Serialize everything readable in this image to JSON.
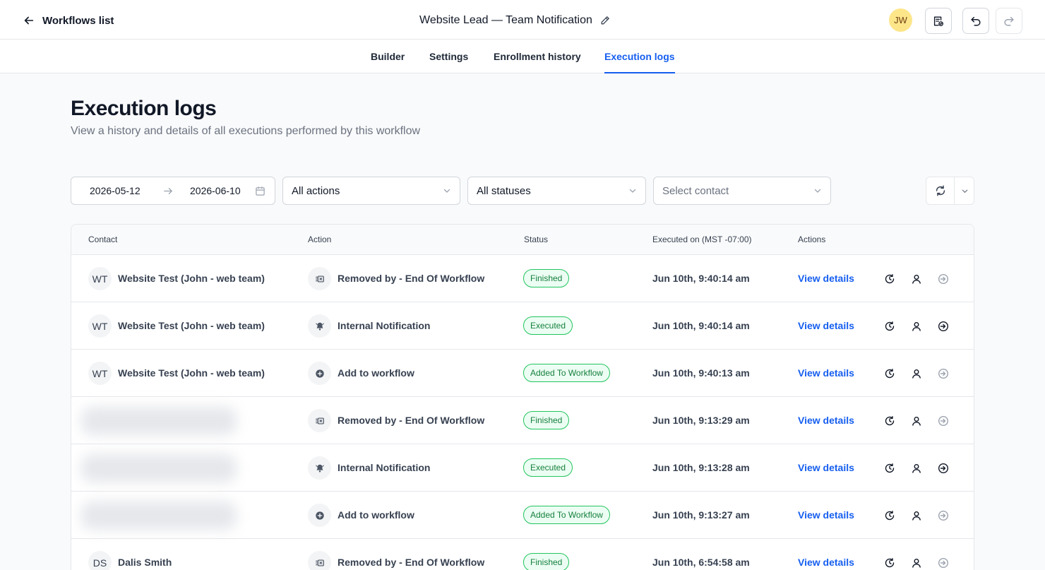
{
  "header": {
    "back_label": "Workflows list",
    "workflow_title": "Website Lead — Team Notification",
    "user_initials": "JW"
  },
  "tabs": [
    {
      "label": "Builder",
      "active": false
    },
    {
      "label": "Settings",
      "active": false
    },
    {
      "label": "Enrollment history",
      "active": false
    },
    {
      "label": "Execution logs",
      "active": true
    }
  ],
  "page": {
    "title": "Execution logs",
    "subtitle": "View a history and details of all executions performed by this workflow"
  },
  "filters": {
    "date_from": "2026-05-12",
    "date_to": "2026-06-10",
    "actions_value": "All actions",
    "statuses_value": "All statuses",
    "contact_placeholder": "Select contact"
  },
  "table": {
    "columns": {
      "contact": "Contact",
      "action": "Action",
      "status": "Status",
      "executed_on": "Executed on (MST -07:00)",
      "actions": "Actions"
    },
    "view_label": "View details",
    "rows": [
      {
        "initials": "WT",
        "contact": "Website Test (John - web team)",
        "action": "Removed by - End Of Workflow",
        "action_icon": "remove-icon",
        "status": "Finished",
        "executed": "Jun 10th, 9:40:14 am",
        "enter_active": false
      },
      {
        "initials": "WT",
        "contact": "Website Test (John - web team)",
        "action": "Internal Notification",
        "action_icon": "bell-icon",
        "status": "Executed",
        "executed": "Jun 10th, 9:40:14 am",
        "enter_active": true
      },
      {
        "initials": "WT",
        "contact": "Website Test (John - web team)",
        "action": "Add to workflow",
        "action_icon": "plus-circle-icon",
        "status": "Added To Workflow",
        "executed": "Jun 10th, 9:40:13 am",
        "enter_active": false
      },
      {
        "initials": "",
        "contact": "",
        "blurred": true,
        "action": "Removed by - End Of Workflow",
        "action_icon": "remove-icon",
        "status": "Finished",
        "executed": "Jun 10th, 9:13:29 am",
        "enter_active": false
      },
      {
        "initials": "",
        "contact": "",
        "blurred": true,
        "action": "Internal Notification",
        "action_icon": "bell-icon",
        "status": "Executed",
        "executed": "Jun 10th, 9:13:28 am",
        "enter_active": true
      },
      {
        "initials": "",
        "contact": "",
        "blurred": true,
        "action": "Add to workflow",
        "action_icon": "plus-circle-icon",
        "status": "Added To Workflow",
        "executed": "Jun 10th, 9:13:27 am",
        "enter_active": false
      },
      {
        "initials": "DS",
        "contact": "Dalis Smith",
        "action": "Removed by - End Of Workflow",
        "action_icon": "remove-icon",
        "status": "Finished",
        "executed": "Jun 10th, 6:54:58 am",
        "enter_active": false
      }
    ]
  },
  "colors": {
    "accent": "#155eef",
    "badge_border": "#22c55e",
    "badge_text": "#15803d",
    "badge_bg": "#ecfdf3",
    "avatar_top": "#fde68a"
  }
}
